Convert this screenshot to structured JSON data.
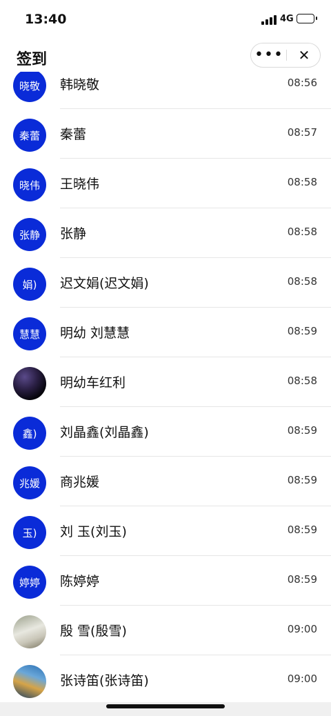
{
  "status_bar": {
    "time": "13:40",
    "network": "4G"
  },
  "header": {
    "title": "签到",
    "more_glyph": "•••",
    "close_glyph": "✕"
  },
  "rows": [
    {
      "avatar_text": "晓敬",
      "name": "韩晓敬",
      "time": "08:56"
    },
    {
      "avatar_text": "秦蕾",
      "name": "秦蕾",
      "time": "08:57"
    },
    {
      "avatar_text": "晓伟",
      "name": "王晓伟",
      "time": "08:58"
    },
    {
      "avatar_text": "张静",
      "name": "张静",
      "time": "08:58"
    },
    {
      "avatar_text": "娟)",
      "name": "迟文娟(迟文娟)",
      "time": "08:58"
    },
    {
      "avatar_text": "慧慧",
      "name": "明幼 刘慧慧",
      "time": "08:59"
    },
    {
      "avatar_text": "",
      "name": "明幼车红利",
      "time": "08:58"
    },
    {
      "avatar_text": "鑫)",
      "name": "刘晶鑫(刘晶鑫)",
      "time": "08:59"
    },
    {
      "avatar_text": "兆媛",
      "name": "商兆媛",
      "time": "08:59"
    },
    {
      "avatar_text": "玉)",
      "name": "刘 玉(刘玉)",
      "time": "08:59"
    },
    {
      "avatar_text": "婷婷",
      "name": "陈婷婷",
      "time": "08:59"
    },
    {
      "avatar_text": "",
      "name": "殷 雪(殷雪)",
      "time": "09:00"
    },
    {
      "avatar_text": "",
      "name": "张诗笛(张诗笛)",
      "time": "09:00"
    }
  ]
}
